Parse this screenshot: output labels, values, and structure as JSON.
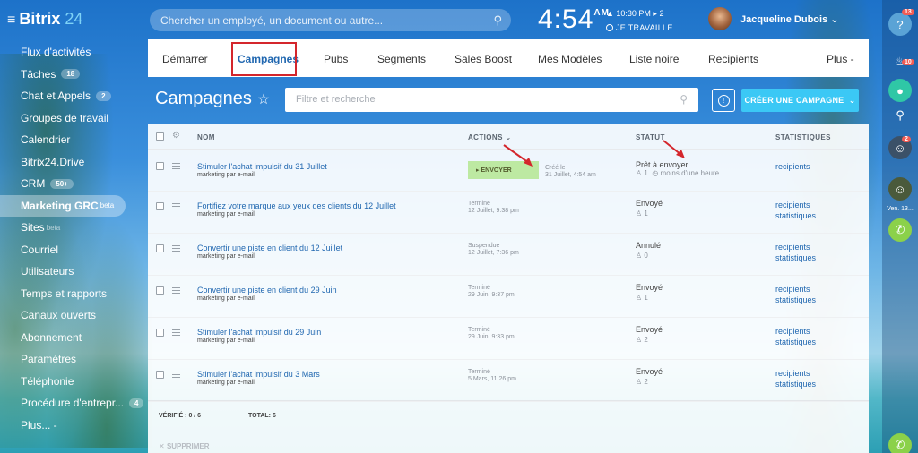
{
  "header": {
    "logo_text": "Bitrix",
    "logo_num": "24",
    "search_placeholder": "Chercher un employé, un document ou autre...",
    "time": "4:54",
    "ampm": "AM",
    "alarm": "▲ 10:30 PM  ▸ 2",
    "work_status": "JE TRAVAILLE",
    "user_name": "Jacqueline Dubois ⌄"
  },
  "sidebar": {
    "items": [
      {
        "label": "Flux d'activités"
      },
      {
        "label": "Tâches",
        "count": "18"
      },
      {
        "label": "Chat et Appels",
        "count": "2"
      },
      {
        "label": "Groupes de travail"
      },
      {
        "label": "Calendrier"
      },
      {
        "label": "Bitrix24.Drive"
      },
      {
        "label": "CRM",
        "count": "50+"
      },
      {
        "label": "Marketing GRC",
        "tag": "beta"
      },
      {
        "label": "Sites",
        "tag": "beta"
      },
      {
        "label": "Courriel"
      },
      {
        "label": "Utilisateurs"
      },
      {
        "label": "Temps et rapports"
      },
      {
        "label": "Canaux ouverts"
      },
      {
        "label": "Abonnement"
      },
      {
        "label": "Paramètres"
      },
      {
        "label": "Téléphonie"
      },
      {
        "label": "Procédure d'entrepr...",
        "count": "4"
      },
      {
        "label": "Plus... -"
      }
    ]
  },
  "rail": {
    "help_badge": "13",
    "bell_badge": "10",
    "chat_badge": "2",
    "date_text": "Ven. 13..."
  },
  "nav": {
    "tabs": [
      "Démarrer",
      "Campagnes",
      "Pubs",
      "Segments",
      "Sales Boost",
      "Mes Modèles",
      "Liste noire",
      "Recipients",
      "Plus -"
    ],
    "active_index": 1
  },
  "page": {
    "title": "Campagnes",
    "filter_placeholder": "Filtre et recherche",
    "create_button": "CRÉER UNE CAMPAGNE"
  },
  "grid": {
    "columns": {
      "name": "NOM",
      "actions": "ACTIONS",
      "status": "STATUT",
      "stats": "STATISTIQUES"
    },
    "rows": [
      {
        "name": "Stimuler l'achat impulsif du 31 Juillet",
        "type": "marketing par e-mail",
        "send_label": "ENVOYER",
        "created_label": "Créé le",
        "created_date": "31 Juillet, 4:54 am",
        "status": "Prêt à envoyer",
        "recipients": "1",
        "extra": "moins d'une heure",
        "links": [
          "recipients"
        ]
      },
      {
        "name": "Fortifiez votre marque aux yeux des clients du 12 Juillet",
        "type": "marketing par e-mail",
        "action_state": "Terminé",
        "action_date": "12 Juillet, 9:38 pm",
        "status": "Envoyé",
        "recipients": "1",
        "links": [
          "recipients",
          "statistiques"
        ]
      },
      {
        "name": "Convertir une piste en client du 12 Juillet",
        "type": "marketing par e-mail",
        "action_state": "Suspendue",
        "action_date": "12 Juillet, 7:36 pm",
        "status": "Annulé",
        "recipients": "0",
        "links": [
          "recipients",
          "statistiques"
        ]
      },
      {
        "name": "Convertir une piste en client du 29 Juin",
        "type": "marketing par e-mail",
        "action_state": "Terminé",
        "action_date": "29 Juin, 9:37 pm",
        "status": "Envoyé",
        "recipients": "1",
        "links": [
          "recipients",
          "statistiques"
        ]
      },
      {
        "name": "Stimuler l'achat impulsif du 29 Juin",
        "type": "marketing par e-mail",
        "action_state": "Terminé",
        "action_date": "29 Juin, 9:33 pm",
        "status": "Envoyé",
        "recipients": "2",
        "links": [
          "recipients",
          "statistiques"
        ]
      },
      {
        "name": "Stimuler l'achat impulsif du 3 Mars",
        "type": "marketing par e-mail",
        "action_state": "Terminé",
        "action_date": "5 Mars, 11:26 pm",
        "status": "Envoyé",
        "recipients": "2",
        "links": [
          "recipients",
          "statistiques"
        ]
      }
    ],
    "footer_verified": "VÉRIFIÉ : 0 / 6",
    "footer_total": "TOTAL: 6",
    "delete_label": "SUPPRIMER"
  },
  "colors": {
    "accent": "#3bc8f5",
    "link": "#2067b0",
    "highlight": "#d4262c",
    "send": "#bde9a2"
  }
}
